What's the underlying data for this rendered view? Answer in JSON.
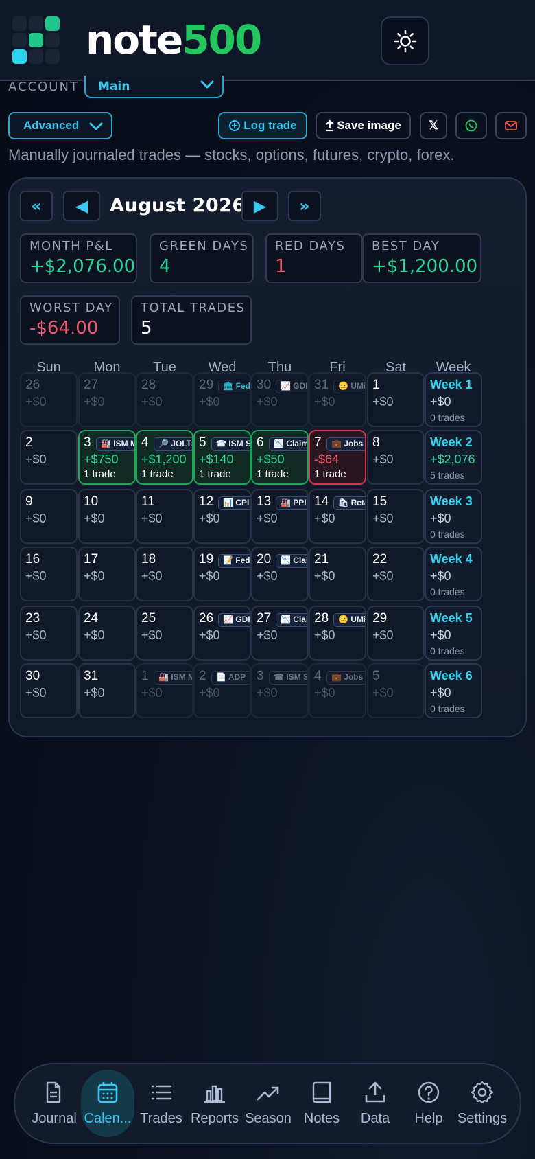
{
  "brand": {
    "name_part1": "note",
    "name_part2": "500"
  },
  "account": {
    "label": "ACCOUNT",
    "value": "Main"
  },
  "toolbar": {
    "mode_value": "Advanced",
    "log_trade_label": "Log trade",
    "save_image_label": "Save image",
    "x_label": "𝕏"
  },
  "subtitle": "Manually journaled trades — stocks, options, futures, crypto, forex.",
  "calendar": {
    "nav_first": "«",
    "nav_prev": "◀",
    "nav_next": "▶",
    "nav_last": "»",
    "month_title": "August 2026",
    "stats": [
      {
        "label": "MONTH P&L",
        "value": "+$2,076.00",
        "tone": "green"
      },
      {
        "label": "GREEN DAYS",
        "value": "4",
        "tone": "green"
      },
      {
        "label": "RED DAYS",
        "value": "1",
        "tone": "red"
      },
      {
        "label": "BEST DAY",
        "value": "+$1,200.00",
        "tone": "green"
      },
      {
        "label": "WORST DAY",
        "value": "-$64.00",
        "tone": "red"
      },
      {
        "label": "TOTAL TRADES",
        "value": "5",
        "tone": "white"
      }
    ],
    "weekdays": [
      "Sun",
      "Mon",
      "Tue",
      "Wed",
      "Thu",
      "Fri",
      "Sat",
      "Week"
    ],
    "weeks": [
      {
        "days": [
          {
            "day": "26",
            "pnl": "+$0",
            "state": "dim"
          },
          {
            "day": "27",
            "pnl": "+$0",
            "state": "dim"
          },
          {
            "day": "28",
            "pnl": "+$0",
            "state": "dim"
          },
          {
            "day": "29",
            "pnl": "+$0",
            "state": "dim",
            "event": "🏛 Fed",
            "event_tone": "cyan"
          },
          {
            "day": "30",
            "pnl": "+$0",
            "state": "dim",
            "event": "📈 GDP"
          },
          {
            "day": "31",
            "pnl": "+$0",
            "state": "dim",
            "event": "😐 UMi"
          },
          {
            "day": "1",
            "pnl": "+$0",
            "state": "normal"
          }
        ],
        "summary": {
          "label": "Week 1",
          "pnl": "+$0",
          "trades": "0 trades"
        }
      },
      {
        "days": [
          {
            "day": "2",
            "pnl": "+$0",
            "state": "normal"
          },
          {
            "day": "3",
            "pnl": "+$750",
            "state": "win",
            "event": "🏭 ISM M",
            "trades": "1 trade"
          },
          {
            "day": "4",
            "pnl": "+$1,200",
            "state": "win",
            "event": "🔎 JOLTS",
            "trades": "1 trade"
          },
          {
            "day": "5",
            "pnl": "+$140",
            "state": "win",
            "event": "☎ ISM Sv",
            "trades": "1 trade"
          },
          {
            "day": "6",
            "pnl": "+$50",
            "state": "win",
            "event": "📉 Claims",
            "trades": "1 trade"
          },
          {
            "day": "7",
            "pnl": "-$64",
            "state": "loss",
            "event": "💼 Jobs",
            "trades": "1 trade"
          },
          {
            "day": "8",
            "pnl": "+$0",
            "state": "normal"
          }
        ],
        "summary": {
          "label": "Week 2",
          "pnl": "+$2,076",
          "trades": "5 trades",
          "positive": true
        }
      },
      {
        "days": [
          {
            "day": "9",
            "pnl": "+$0",
            "state": "normal"
          },
          {
            "day": "10",
            "pnl": "+$0",
            "state": "normal"
          },
          {
            "day": "11",
            "pnl": "+$0",
            "state": "normal"
          },
          {
            "day": "12",
            "pnl": "+$0",
            "state": "normal",
            "event": "📊 CPI"
          },
          {
            "day": "13",
            "pnl": "+$0",
            "state": "normal",
            "event": "🏭 PPI"
          },
          {
            "day": "14",
            "pnl": "+$0",
            "state": "normal",
            "event": "🛍 Retail"
          },
          {
            "day": "15",
            "pnl": "+$0",
            "state": "normal"
          }
        ],
        "summary": {
          "label": "Week 3",
          "pnl": "+$0",
          "trades": "0 trades"
        }
      },
      {
        "days": [
          {
            "day": "16",
            "pnl": "+$0",
            "state": "normal"
          },
          {
            "day": "17",
            "pnl": "+$0",
            "state": "normal"
          },
          {
            "day": "18",
            "pnl": "+$0",
            "state": "normal"
          },
          {
            "day": "19",
            "pnl": "+$0",
            "state": "normal",
            "event": "📝 Fed"
          },
          {
            "day": "20",
            "pnl": "+$0",
            "state": "normal",
            "event": "📉 Clai"
          },
          {
            "day": "21",
            "pnl": "+$0",
            "state": "normal"
          },
          {
            "day": "22",
            "pnl": "+$0",
            "state": "normal"
          }
        ],
        "summary": {
          "label": "Week 4",
          "pnl": "+$0",
          "trades": "0 trades"
        }
      },
      {
        "days": [
          {
            "day": "23",
            "pnl": "+$0",
            "state": "normal"
          },
          {
            "day": "24",
            "pnl": "+$0",
            "state": "normal"
          },
          {
            "day": "25",
            "pnl": "+$0",
            "state": "normal"
          },
          {
            "day": "26",
            "pnl": "+$0",
            "state": "normal",
            "event": "📈 GDP"
          },
          {
            "day": "27",
            "pnl": "+$0",
            "state": "normal",
            "event": "📉 Clai"
          },
          {
            "day": "28",
            "pnl": "+$0",
            "state": "normal",
            "event": "😐 UMi"
          },
          {
            "day": "29",
            "pnl": "+$0",
            "state": "normal"
          }
        ],
        "summary": {
          "label": "Week 5",
          "pnl": "+$0",
          "trades": "0 trades"
        }
      },
      {
        "days": [
          {
            "day": "30",
            "pnl": "+$0",
            "state": "normal"
          },
          {
            "day": "31",
            "pnl": "+$0",
            "state": "normal"
          },
          {
            "day": "1",
            "pnl": "+$0",
            "state": "dim",
            "event": "🏭 ISM M"
          },
          {
            "day": "2",
            "pnl": "+$0",
            "state": "dim",
            "event": "📄 ADP"
          },
          {
            "day": "3",
            "pnl": "+$0",
            "state": "dim",
            "event": "☎ ISM Sv"
          },
          {
            "day": "4",
            "pnl": "+$0",
            "state": "dim",
            "event": "💼 Jobs"
          },
          {
            "day": "5",
            "pnl": "+$0",
            "state": "dim"
          }
        ],
        "summary": {
          "label": "Week 6",
          "pnl": "+$0",
          "trades": "0 trades"
        }
      }
    ]
  },
  "bottom_nav": [
    {
      "label": "Journal",
      "icon": "journal-icon"
    },
    {
      "label": "Calen...",
      "icon": "calendar-icon",
      "active": true
    },
    {
      "label": "Trades",
      "icon": "list-icon"
    },
    {
      "label": "Reports",
      "icon": "bar-chart-icon"
    },
    {
      "label": "Season",
      "icon": "trend-icon"
    },
    {
      "label": "Notes",
      "icon": "book-icon"
    },
    {
      "label": "Data",
      "icon": "upload-icon"
    },
    {
      "label": "Help",
      "icon": "help-icon"
    },
    {
      "label": "Settings",
      "icon": "gear-icon"
    }
  ],
  "colors": {
    "accent": "#38c8f0",
    "brand_green": "#22c55e",
    "profit": "#2fd49a",
    "loss": "#ef5a6f"
  }
}
